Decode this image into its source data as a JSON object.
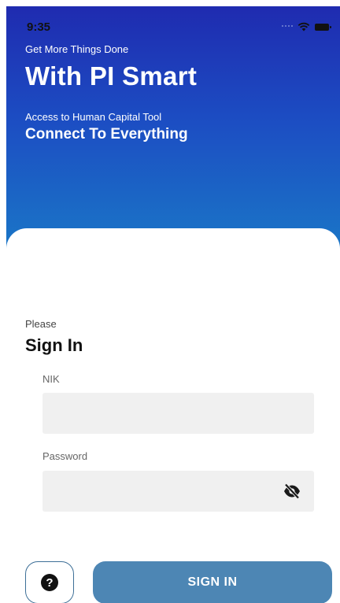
{
  "status_bar": {
    "time": "9:35"
  },
  "hero": {
    "tagline": "Get More Things Done",
    "title": "With PI Smart",
    "subtitle": "Access to Human Capital Tool",
    "subtitle_bold": "Connect To Everything"
  },
  "form": {
    "please": "Please",
    "heading": "Sign In",
    "nik_label": "NIK",
    "nik_value": "",
    "password_label": "Password",
    "password_value": ""
  },
  "actions": {
    "help_icon": "question-circle-icon",
    "signin_label": "SIGN IN"
  },
  "colors": {
    "gradient_top": "#1f2bb0",
    "gradient_bottom": "#1a7bc7",
    "button": "#4d86b4"
  }
}
